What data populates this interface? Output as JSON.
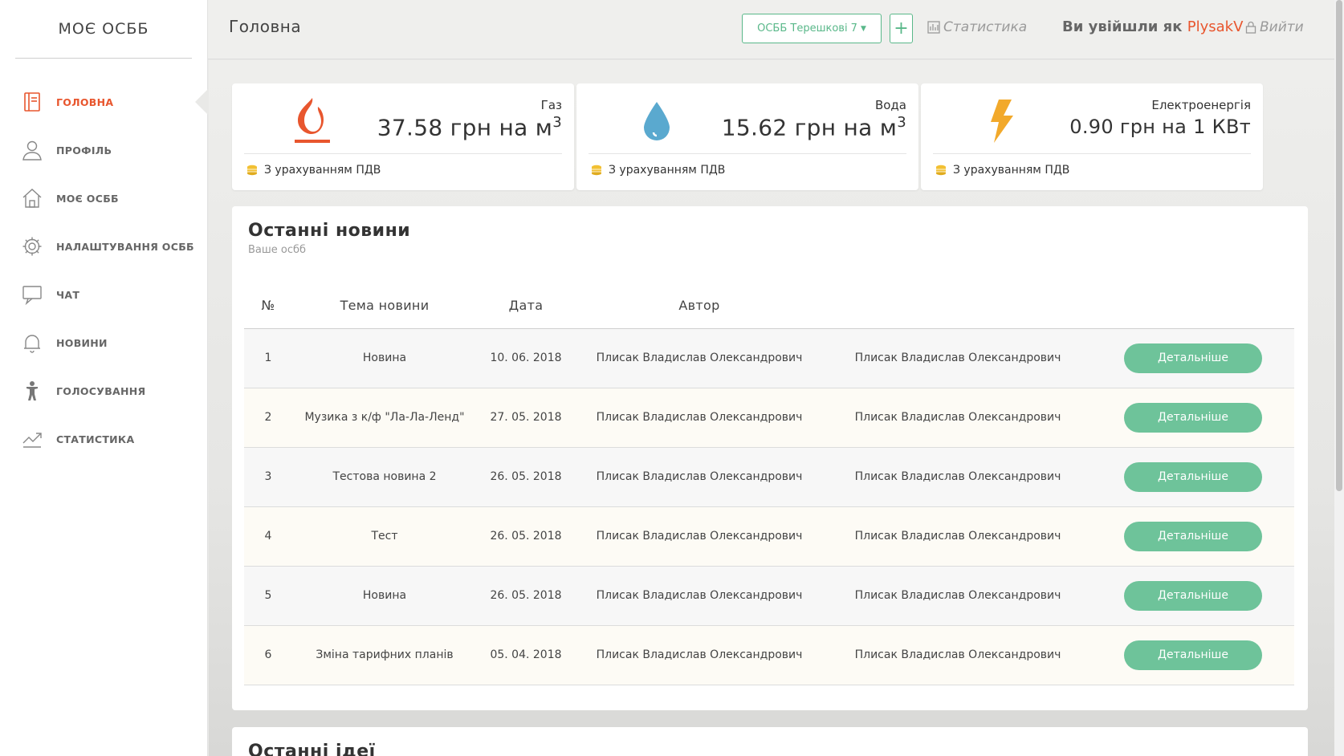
{
  "brand": "МОЄ ОСББ",
  "sidebar": {
    "items": [
      {
        "label": "ГОЛОВНА",
        "icon": "book-icon",
        "active": true
      },
      {
        "label": "ПРОФІЛЬ",
        "icon": "user-icon"
      },
      {
        "label": "МОЄ ОСББ",
        "icon": "home-icon"
      },
      {
        "label": "НАЛАШТУВАННЯ ОСББ",
        "icon": "gear-icon"
      },
      {
        "label": "ЧАТ",
        "icon": "chat-icon"
      },
      {
        "label": "НОВИНИ",
        "icon": "bell-icon"
      },
      {
        "label": "ГОЛОСУВАННЯ",
        "icon": "person-icon"
      },
      {
        "label": "СТАТИСТИКА",
        "icon": "trend-icon"
      }
    ]
  },
  "header": {
    "title": "Головна",
    "osbb_select": "ОСББ Терешкові 7",
    "add_label": "+",
    "stats_label": "Статистика",
    "logged_prefix": "Ви увійшли як ",
    "username": "PlysakV",
    "logout_label": "Вийти"
  },
  "utilities": [
    {
      "name": "Газ",
      "price": "37.58 грн на м",
      "unit_sup": "3",
      "note": "З урахуванням ПДВ",
      "icon": "flame-icon",
      "color": "#e8562e"
    },
    {
      "name": "Вода",
      "price": "15.62 грн на м",
      "unit_sup": "3",
      "note": "З урахуванням ПДВ",
      "icon": "drop-icon",
      "color": "#5aa9cf"
    },
    {
      "name": "Електроенергія",
      "price": "0.90 грн на 1 КВт",
      "unit_sup": "",
      "note": "З урахуванням ПДВ",
      "icon": "bolt-icon",
      "color": "#f2a92b"
    }
  ],
  "news": {
    "title": "Останні новини",
    "subtitle": "Ваше осбб",
    "columns": [
      "№",
      "Тема новини",
      "Дата",
      "Автор"
    ],
    "button_label": "Детальніше",
    "rows": [
      {
        "num": "1",
        "topic": "Новина",
        "date": "10. 06. 2018",
        "author": "Плисак Владислав Олександрович",
        "author2": "Плисак Владислав Олександрович"
      },
      {
        "num": "2",
        "topic": "Музика з к/ф \"Ла-Ла-Ленд\"",
        "date": "27. 05. 2018",
        "author": "Плисак Владислав Олександрович",
        "author2": "Плисак Владислав Олександрович"
      },
      {
        "num": "3",
        "topic": "Тестова новина 2",
        "date": "26. 05. 2018",
        "author": "Плисак Владислав Олександрович",
        "author2": "Плисак Владислав Олександрович"
      },
      {
        "num": "4",
        "topic": "Тест",
        "date": "26. 05. 2018",
        "author": "Плисак Владислав Олександрович",
        "author2": "Плисак Владислав Олександрович"
      },
      {
        "num": "5",
        "topic": "Новина",
        "date": "26. 05. 2018",
        "author": "Плисак Владислав Олександрович",
        "author2": "Плисак Владислав Олександрович"
      },
      {
        "num": "6",
        "topic": "Зміна тарифних планів",
        "date": "05. 04. 2018",
        "author": "Плисак Владислав Олександрович",
        "author2": "Плисак Владислав Олександрович"
      }
    ]
  },
  "ideas": {
    "title": "Останні ідеї"
  }
}
